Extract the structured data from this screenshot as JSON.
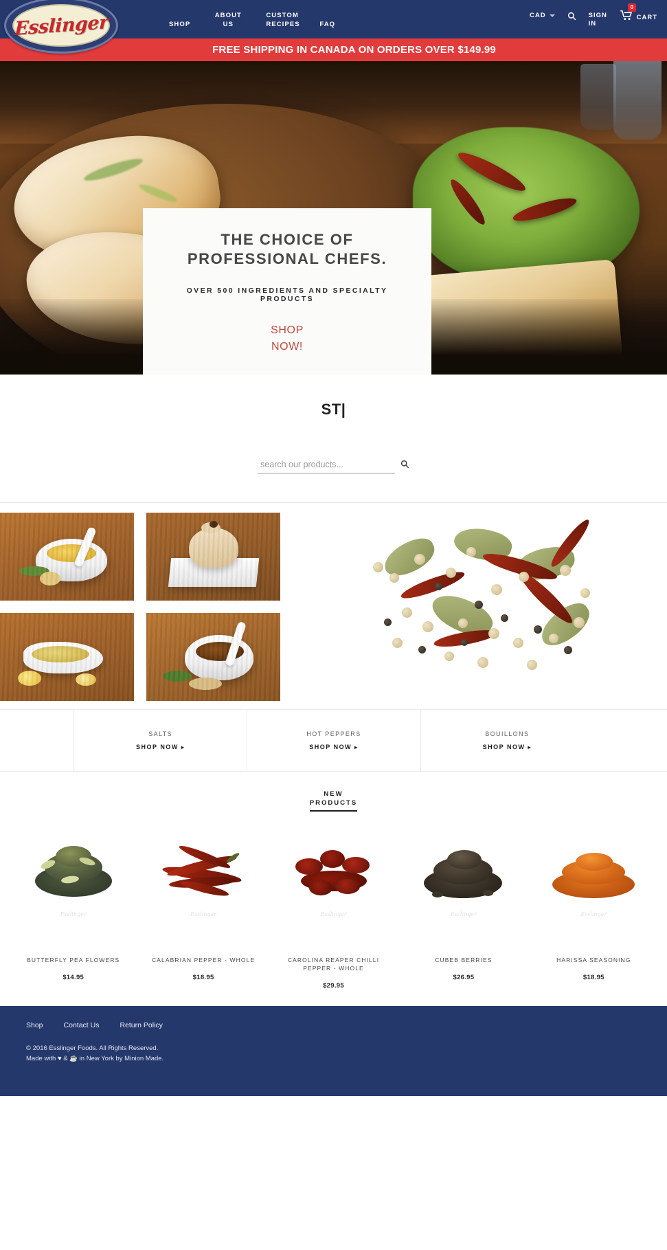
{
  "header": {
    "logo_text": "Esslinger",
    "nav": [
      {
        "label": "SHOP",
        "pos": "bottom"
      },
      {
        "label": "ABOUT US",
        "pos": "top"
      },
      {
        "label": "CUSTOM RECIPES",
        "pos": "top"
      },
      {
        "label": "FAQ",
        "pos": "bottom"
      }
    ],
    "currency": "CAD",
    "search_icon": "search-icon",
    "signin_label": "SIGN IN",
    "cart_label": "CART",
    "cart_count": "0",
    "cart_badge_color": "#e0282e",
    "bar_color": "#25386c"
  },
  "promo": {
    "text": "FREE SHIPPING IN CANADA ON ORDERS OVER $149.99",
    "bg_color": "#e23b3b"
  },
  "hero": {
    "heading": "THE CHOICE OF PROFESSIONAL CHEFS.",
    "subheading": "OVER 500 INGREDIENTS AND SPECIALTY PRODUCTS",
    "cta_line1": "SHOP",
    "cta_line2": "NOW!",
    "cta_color": "#c0483f"
  },
  "middle": {
    "typed_text": "ST|",
    "search_placeholder": "search our products...",
    "search_value": "",
    "search_icon": "magnifier-icon"
  },
  "collections": [
    {
      "title": "SALTS",
      "cta": "SHOP NOW",
      "arrow": "▸"
    },
    {
      "title": "HOT PEPPERS",
      "cta": "SHOP NOW",
      "arrow": "▸"
    },
    {
      "title": "BOUILLONS",
      "cta": "SHOP NOW",
      "arrow": "▸"
    }
  ],
  "new_products": {
    "title_line1": "NEW",
    "title_line2": "PRODUCTS",
    "items": [
      {
        "name": "BUTTERFLY PEA FLOWERS",
        "price": "$14.95"
      },
      {
        "name": "CALABRIAN PEPPER - WHOLE",
        "price": "$18.95"
      },
      {
        "name": "CAROLINA REAPER CHILLI PEPPER - WHOLE",
        "price": "$29.95"
      },
      {
        "name": "CUBEB BERRIES",
        "price": "$26.95"
      },
      {
        "name": "HARISSA SEASONING",
        "price": "$18.95"
      }
    ]
  },
  "footer": {
    "links": [
      "Shop",
      "Contact Us",
      "Return Policy"
    ],
    "copyright": "© 2016 Esslinger Foods. All Rights Reserved.",
    "made_prefix": "Made with ",
    "made_heart": "♥",
    "made_mid": " & ",
    "made_coffee": "☕",
    "made_suffix": " in New York by Minion Made.",
    "bg_color": "#25386c"
  }
}
